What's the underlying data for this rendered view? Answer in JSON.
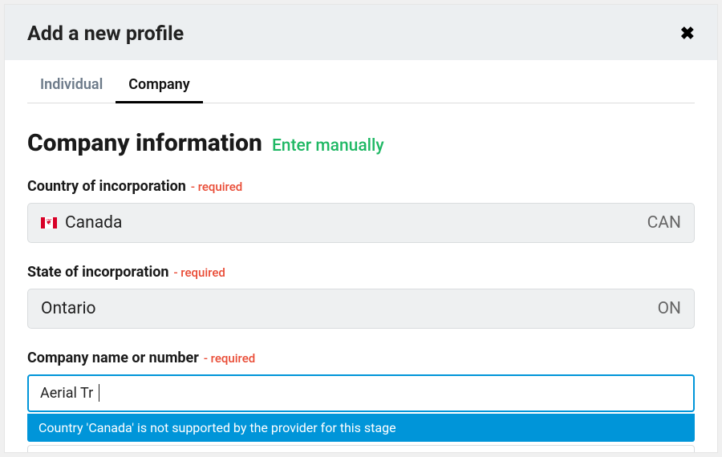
{
  "modal": {
    "title": "Add a new profile",
    "close_icon": "×"
  },
  "tabs": {
    "individual": "Individual",
    "company": "Company"
  },
  "section": {
    "title": "Company information",
    "enter_manually": "Enter manually"
  },
  "required_text": "- required",
  "fields": {
    "country": {
      "label": "Country of incorporation",
      "value": "Canada",
      "code": "CAN",
      "flag": "canada"
    },
    "state": {
      "label": "State of incorporation",
      "value": "Ontario",
      "code": "ON"
    },
    "company_name": {
      "label": "Company name or number",
      "value": "Aerial Tr",
      "notice": "Country 'Canada' is not supported by the provider for this stage"
    }
  }
}
